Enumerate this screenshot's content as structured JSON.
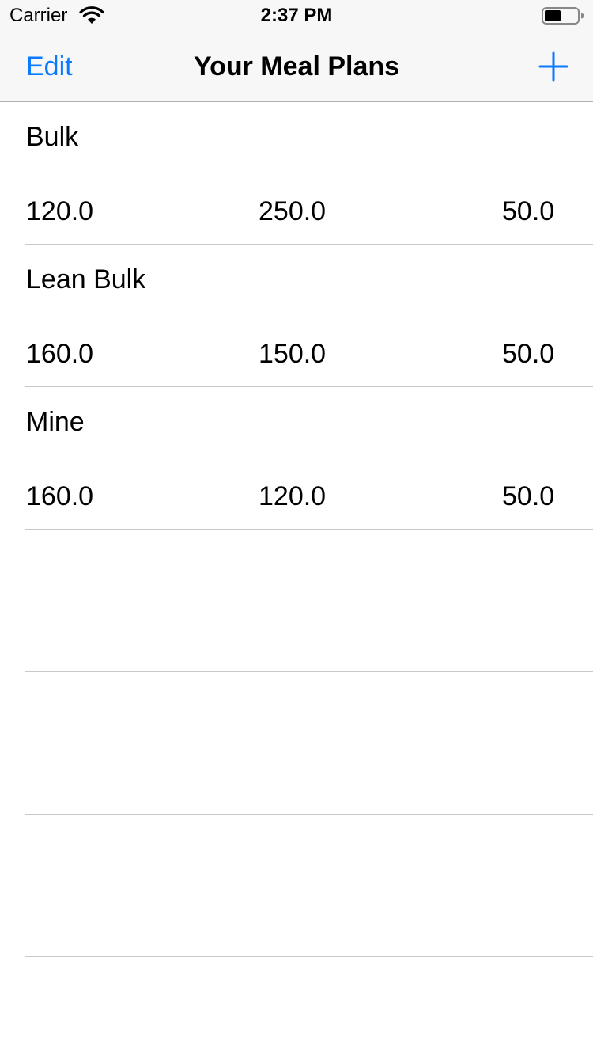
{
  "status_bar": {
    "carrier": "Carrier",
    "time": "2:37 PM",
    "wifi_icon": "wifi-icon",
    "battery_icon": "battery-icon"
  },
  "nav": {
    "edit_label": "Edit",
    "title": "Your Meal Plans",
    "add_icon": "plus-icon",
    "accent_color": "#0a7aff"
  },
  "plans": [
    {
      "name": "Bulk",
      "values": [
        "120.0",
        "250.0",
        "50.0"
      ]
    },
    {
      "name": "Lean Bulk",
      "values": [
        "160.0",
        "150.0",
        "50.0"
      ]
    },
    {
      "name": "Mine",
      "values": [
        "160.0",
        "120.0",
        "50.0"
      ]
    }
  ]
}
